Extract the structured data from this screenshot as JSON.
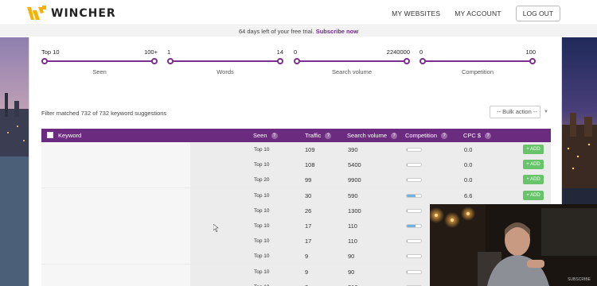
{
  "header": {
    "logo_text": "WINCHER",
    "nav": [
      "MY WEBSITES",
      "MY ACCOUNT"
    ],
    "logout": "LOG OUT"
  },
  "trial": {
    "text": "64 days left of your free trial.",
    "link": "Subscribe now"
  },
  "sliders": [
    {
      "min": "Top 10",
      "max": "100+",
      "label": "Seen"
    },
    {
      "min": "1",
      "max": "14",
      "label": "Words"
    },
    {
      "min": "0",
      "max": "2240000",
      "label": "Search volume"
    },
    {
      "min": "0",
      "max": "100",
      "label": "Competition"
    }
  ],
  "filter_text": "Filter matched 732 of 732 keyword suggestions",
  "bulk_action": "-- Bulk action --",
  "table": {
    "headers": {
      "keyword": "Keyword",
      "seen": "Seen",
      "traffic": "Traffic",
      "search_volume": "Search volume",
      "competition": "Competition",
      "cpc": "CPC $"
    },
    "help_glyph": "?",
    "add_label": "+ ADD",
    "rows": [
      {
        "seen": "Top 10",
        "traffic": "109",
        "volume": "390",
        "competition": 0.05,
        "cpc": "0.0"
      },
      {
        "seen": "Top 10",
        "traffic": "108",
        "volume": "5400",
        "competition": 0.05,
        "cpc": "0.0"
      },
      {
        "seen": "Top 20",
        "traffic": "99",
        "volume": "9900",
        "competition": 0.05,
        "cpc": "0.0"
      },
      {
        "seen": "Top 10",
        "traffic": "30",
        "volume": "590",
        "competition": 0.6,
        "cpc": "6.6"
      },
      {
        "seen": "Top 10",
        "traffic": "26",
        "volume": "1300",
        "competition": 0.05,
        "cpc": ""
      },
      {
        "seen": "Top 10",
        "traffic": "17",
        "volume": "110",
        "competition": 0.6,
        "cpc": ""
      },
      {
        "seen": "Top 10",
        "traffic": "17",
        "volume": "110",
        "competition": 0.05,
        "cpc": ""
      },
      {
        "seen": "Top 10",
        "traffic": "9",
        "volume": "90",
        "competition": 0.05,
        "cpc": ""
      },
      {
        "seen": "Top 10",
        "traffic": "9",
        "volume": "90",
        "competition": 0.05,
        "cpc": ""
      },
      {
        "seen": "Top 10",
        "traffic": "8",
        "volume": "210",
        "competition": 0.05,
        "cpc": ""
      }
    ]
  },
  "colors": {
    "brand_purple": "#6b2b7e",
    "slider_purple": "#7b2f8e",
    "logo_yellow": "#f5b300",
    "add_green": "#67c46a",
    "competition_blue": "#6ab4e8"
  },
  "icons": [
    "wincher-logo-icon",
    "help-icon",
    "checkbox-icon",
    "mouse-cursor-icon"
  ],
  "webcam": {
    "brand": "SUBSCRIBE"
  }
}
